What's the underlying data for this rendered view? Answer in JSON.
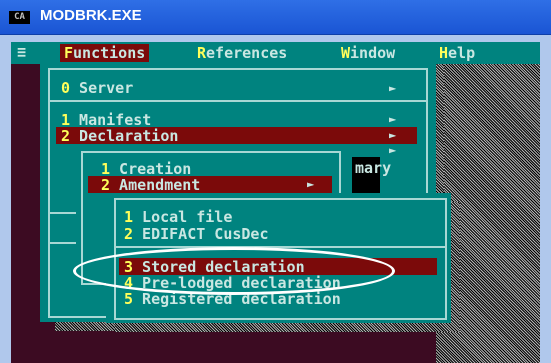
{
  "window": {
    "title": "MODBRK.EXE",
    "icon": "CA"
  },
  "menubar": {
    "system": "≡",
    "items": [
      {
        "hotkey": "F",
        "rest": "unctions"
      },
      {
        "hotkey": "R",
        "rest": "eferences"
      },
      {
        "hotkey": "W",
        "rest": "indow"
      },
      {
        "hotkey": "H",
        "rest": "elp"
      }
    ]
  },
  "main_menu": [
    {
      "num": "0",
      "label": " Server"
    },
    {
      "num": "1",
      "label": " Manifest"
    },
    {
      "num": "2",
      "label": " Declaration"
    }
  ],
  "declaration_menu": [
    {
      "num": "1",
      "label": " Creation"
    },
    {
      "num": "2",
      "label": " Amendment"
    }
  ],
  "background_text": "mary",
  "amendment_menu": [
    {
      "num": "1",
      "label": " Local file"
    },
    {
      "num": "2",
      "label": " EDIFACT CusDec"
    },
    {
      "num": "3",
      "label": " Stored declaration"
    },
    {
      "num": "4",
      "label": " Pre-lodged declaration"
    },
    {
      "num": "5",
      "label": " Registered declaration"
    }
  ],
  "colors": {
    "menu_bg": "#00837f",
    "highlight": "#7b0a0a",
    "hotkey": "#ffff5a",
    "desktop": "#3c0b22"
  }
}
